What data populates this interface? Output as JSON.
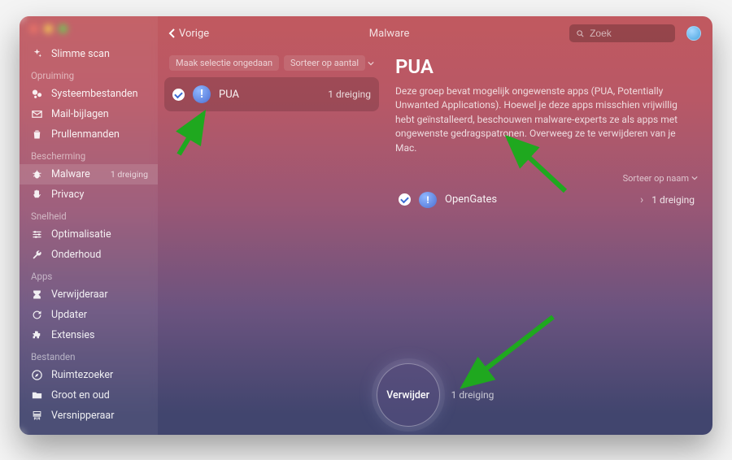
{
  "topbar": {
    "back_label": "Vorige",
    "breadcrumb": "Malware",
    "search_placeholder": "Zoek"
  },
  "sidebar": {
    "items": [
      {
        "label": "Slimme scan",
        "icon": "sparkle-icon"
      }
    ],
    "groups": [
      {
        "label": "Opruiming",
        "items": [
          {
            "label": "Systeembestanden",
            "icon": "bubbles-icon"
          },
          {
            "label": "Mail-bijlagen",
            "icon": "mail-icon"
          },
          {
            "label": "Prullenmanden",
            "icon": "trash-icon"
          }
        ]
      },
      {
        "label": "Bescherming",
        "items": [
          {
            "label": "Malware",
            "icon": "bug-icon",
            "badge": "1 dreiging",
            "active": true
          },
          {
            "label": "Privacy",
            "icon": "hand-icon"
          }
        ]
      },
      {
        "label": "Snelheid",
        "items": [
          {
            "label": "Optimalisatie",
            "icon": "sliders-icon"
          },
          {
            "label": "Onderhoud",
            "icon": "wrench-icon"
          }
        ]
      },
      {
        "label": "Apps",
        "items": [
          {
            "label": "Verwijderaar",
            "icon": "uninstall-icon"
          },
          {
            "label": "Updater",
            "icon": "update-icon"
          },
          {
            "label": "Extensies",
            "icon": "puzzle-icon"
          }
        ]
      },
      {
        "label": "Bestanden",
        "items": [
          {
            "label": "Ruimtezoeker",
            "icon": "compass-icon"
          },
          {
            "label": "Groot en oud",
            "icon": "folder-icon"
          },
          {
            "label": "Versnipperaar",
            "icon": "shredder-icon"
          }
        ]
      }
    ]
  },
  "left_col": {
    "deselect_label": "Maak selectie ongedaan",
    "sort_label": "Sorteer op aantal",
    "group": {
      "title": "PUA",
      "count_label": "1 dreiging"
    }
  },
  "right_panel": {
    "title": "PUA",
    "description": "Deze groep bevat mogelijk ongewenste apps (PUA, Potentially Unwanted Applications). Hoewel je deze apps misschien vrijwillig hebt geïnstalleerd, beschouwen malware-experts ze als apps met ongewenste gedragspatronen. Overweeg ze te verwijderen van je Mac.",
    "sort_label": "Sorteer op naam",
    "item": {
      "name": "OpenGates",
      "count_label": "1 dreiging"
    }
  },
  "bottom": {
    "button_label": "Verwijder",
    "count_label": "1 dreiging"
  }
}
